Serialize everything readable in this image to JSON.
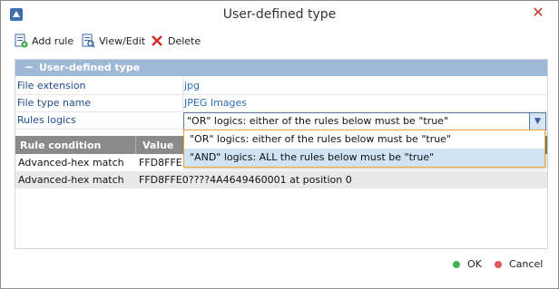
{
  "window": {
    "title": "User-defined type"
  },
  "toolbar": {
    "add_label": "Add rule",
    "view_label": "View/Edit",
    "delete_label": "Delete"
  },
  "section": {
    "title": "User-defined type"
  },
  "props": [
    {
      "label": "File extension",
      "value": "jpg"
    },
    {
      "label": "File type name",
      "value": "JPEG Images"
    },
    {
      "label": "Rules logics",
      "value": "\"OR\" logics: either of the rules below must be \"true\""
    }
  ],
  "grid": {
    "headers": [
      "Rule condition",
      "Value"
    ],
    "rows": [
      {
        "condition": "Advanced-hex match",
        "value": "FFD8FFE1"
      },
      {
        "condition": "Advanced-hex match",
        "value": "FFD8FFE0????4A4649460001 at position 0"
      }
    ]
  },
  "dropdown": {
    "options": [
      "\"OR\" logics: either of the rules below must be \"true\"",
      "\"AND\" logics: ALL the rules below must be \"true\""
    ]
  },
  "footer": {
    "ok_label": "OK",
    "cancel_label": "Cancel"
  },
  "colors": {
    "section_header": "#9fb8d6",
    "ok_dot": "#3fb34f",
    "cancel_dot": "#e0585b",
    "dropdown_border": "#f0a830",
    "selected_row": "#cfe3f5"
  },
  "icons": {
    "app": "app-icon",
    "close": "close-icon",
    "add": "add-rule-icon",
    "view": "view-edit-icon",
    "delete": "delete-icon"
  }
}
